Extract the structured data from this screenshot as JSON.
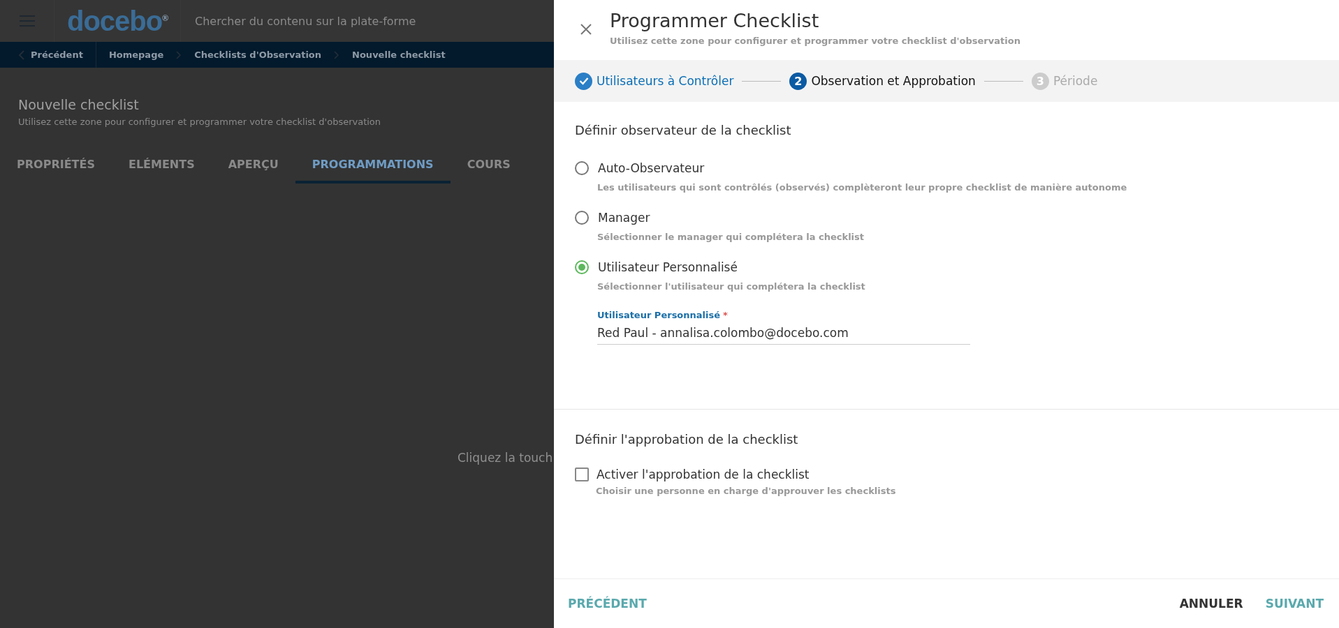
{
  "background_page": {
    "header": {
      "logo": "docebo",
      "logo_mark": "®",
      "search": {
        "placeholder": "Chercher du contenu sur la plate-forme"
      }
    },
    "breadcrumb": {
      "back": "Précédent",
      "items": [
        "Homepage",
        "Checklists d'Observation",
        "Nouvelle checklist"
      ]
    },
    "title": "Nouvelle checklist",
    "subtitle": "Utilisez cette zone pour configurer et programmer votre checklist d'observation",
    "tabs": [
      {
        "label": "PROPRIÉTÉS",
        "selected": false
      },
      {
        "label": "ELÉMENTS",
        "selected": false
      },
      {
        "label": "APERÇU",
        "selected": false
      },
      {
        "label": "PROGRAMMATIONS",
        "selected": true
      },
      {
        "label": "COURS",
        "selected": false
      }
    ],
    "empty_hint": "Cliquez la touch"
  },
  "drawer": {
    "title": "Programmer Checklist",
    "subtitle": "Utilisez cette zone pour configurer et programmer votre checklist d'observation",
    "steps": [
      {
        "label": "Utilisateurs à Contrôler",
        "completed": true,
        "selected": false
      },
      {
        "number": "2",
        "label": "Observation et Approbation",
        "completed": false,
        "selected": true
      },
      {
        "number": "3",
        "label": "Période",
        "completed": false,
        "selected": false
      }
    ],
    "observer_section": {
      "title": "Définir observateur de la checklist",
      "options": [
        {
          "label": "Auto-Observateur",
          "description": "Les utilisateurs qui sont contrôlés (observés) complèteront leur propre checklist de manière autonome",
          "selected": false
        },
        {
          "label": "Manager",
          "description": "Sélectionner le manager qui complétera la checklist",
          "selected": false
        },
        {
          "label": "Utilisateur Personnalisé",
          "description": "Sélectionner l'utilisateur qui complétera la checklist",
          "selected": true
        }
      ],
      "field": {
        "label": "Utilisateur Personnalisé",
        "required_mark": "*",
        "value": "Red Paul - annalisa.colombo@docebo.com"
      }
    },
    "approval_section": {
      "title": "Définir l'approbation de la checklist",
      "checkbox": {
        "label": "Activer l'approbation de la checklist",
        "description": "Choisir une personne en charge d'approuver les checklists",
        "checked": false
      }
    },
    "footer": {
      "back": "PRÉCÉDENT",
      "cancel": "ANNULER",
      "next": "SUIVANT"
    }
  }
}
